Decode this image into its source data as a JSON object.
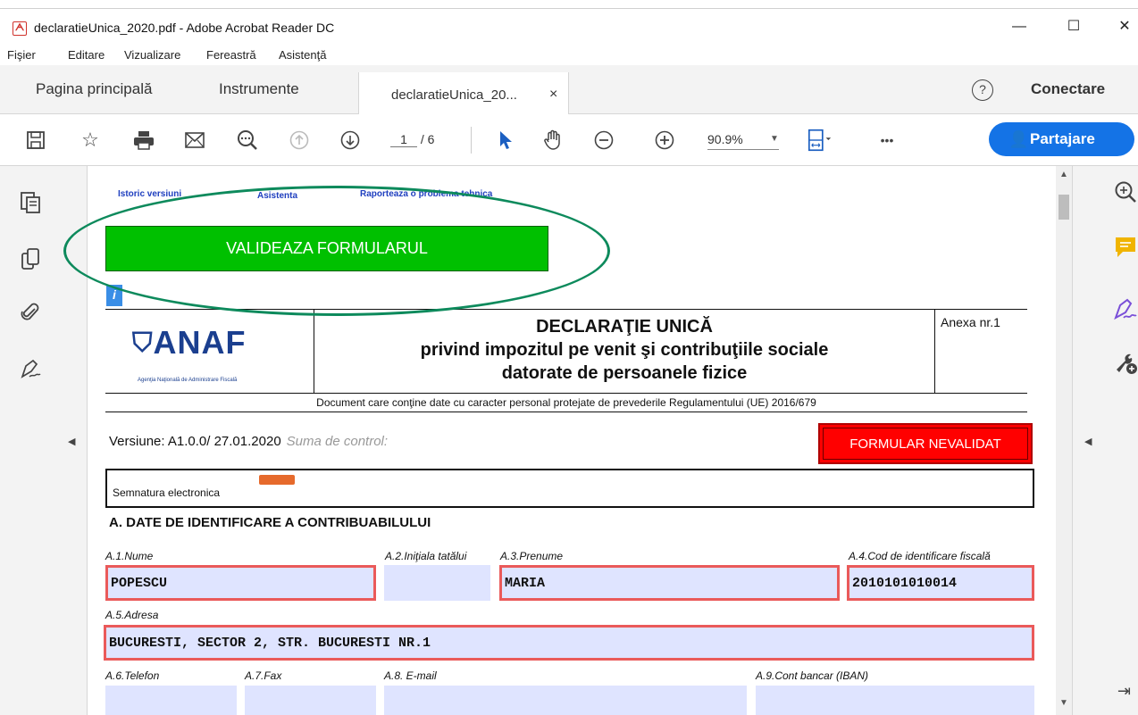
{
  "window": {
    "title": "declaratieUnica_2020.pdf - Adobe Acrobat Reader DC",
    "minimize": "—",
    "maximize": "☐",
    "close": "✕"
  },
  "menu": [
    "Fişier",
    "Editare",
    "Vizualizare",
    "Fereastră",
    "Asistenţă"
  ],
  "tabs": {
    "home": "Pagina principală",
    "tools": "Instrumente",
    "document": "declaratieUnica_20...",
    "close": "×",
    "help": "?",
    "connect": "Conectare"
  },
  "toolbar": {
    "page_current": "1",
    "page_total": "/ 6",
    "zoom": "90.9%",
    "more": "•••",
    "share": "Partajare",
    "icons": [
      "save-icon",
      "bookmark-icon",
      "print-icon",
      "email-icon",
      "search-icon",
      "page-up-icon",
      "page-down-icon",
      "select-icon",
      "hand-icon",
      "zoom-out-icon",
      "zoom-in-icon",
      "fit-page-icon",
      "more-icon",
      "share-icon"
    ]
  },
  "document": {
    "links": [
      "Istoric versiuni",
      "Asistenta",
      "Raporteaza o problema tehnica"
    ],
    "validate_button": "VALIDEAZA FORMULARUL",
    "info_icon": "i",
    "logo_text": "ANAF",
    "logo_sub": "Agenţia Naţională de Administrare Fiscală",
    "title_line1": "DECLARAŢIE UNICĂ",
    "title_line2": "privind impozitul pe venit şi contribuţiile sociale",
    "title_line3": "datorate de persoanele fizice",
    "annex": "Anexa nr.1",
    "gdpr_note": "Document care conţine date cu caracter personal protejate de prevederile Regulamentului (UE) 2016/679",
    "version": "Versiune: A1.0.0/ 27.01.2020",
    "checksum_label": "Suma de control:",
    "status_button": "FORMULAR NEVALIDAT",
    "esign_label": "Semnatura electronica",
    "section_a": "A. DATE DE IDENTIFICARE A CONTRIBUABILULUI",
    "fields": {
      "a1_label": "A.1.Nume",
      "a1_value": "POPESCU",
      "a2_label": "A.2.Iniţiala tatălui",
      "a2_value": "",
      "a3_label": "A.3.Prenume",
      "a3_value": "MARIA",
      "a4_label": "A.4.Cod de identificare fiscală",
      "a4_value": "2010101010014",
      "a5_label": "A.5.Adresa",
      "a5_value": "BUCURESTI, SECTOR 2, STR. BUCURESTI NR.1",
      "a6_label": "A.6.Telefon",
      "a7_label": "A.7.Fax",
      "a8_label": "A.8. E-mail",
      "a9_label": "A.9.Cont bancar (IBAN)"
    }
  },
  "colors": {
    "accent": "#1473e6",
    "validate_green": "#00c000",
    "error_red": "#ff0000",
    "annotation_ellipse": "#0d8a5c",
    "field_fill": "#dfe4ff",
    "field_error_border": "#ea5a5a"
  }
}
